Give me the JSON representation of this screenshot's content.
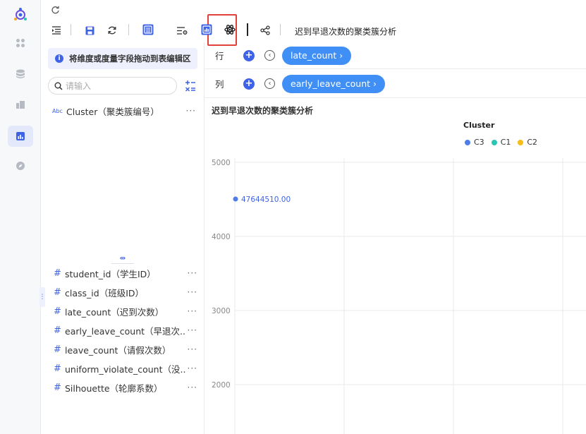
{
  "toolbar": {
    "refresh_icon": "refresh-icon",
    "chart_title": "迟到早退次数的聚类簇分析"
  },
  "fields_panel": {
    "hint": "将维度或度量字段拖动到表编辑区",
    "hint_icon": "i",
    "search_placeholder": "请输入",
    "dimensions": [
      {
        "type": "Abc",
        "name": "Cluster（聚类簇编号）"
      }
    ],
    "measures": [
      {
        "type": "#",
        "name": "student_id（学生ID）"
      },
      {
        "type": "#",
        "name": "class_id（班级ID）"
      },
      {
        "type": "#",
        "name": "late_count（迟到次数）"
      },
      {
        "type": "#",
        "name": "early_leave_count（早退次..."
      },
      {
        "type": "#",
        "name": "leave_count（请假次数）"
      },
      {
        "type": "#",
        "name": "uniform_violate_count（没..."
      },
      {
        "type": "#",
        "name": "Silhouette（轮廓系数）"
      }
    ],
    "more": "···"
  },
  "shelves": {
    "rows": {
      "label": "行",
      "pill": "late_count ›"
    },
    "columns": {
      "label": "列",
      "pill": "early_leave_count ›"
    }
  },
  "chart_data": {
    "type": "scatter",
    "title": "迟到早退次数的聚类簇分析",
    "legend_title": "Cluster",
    "legend_position": "top-right",
    "series": [
      {
        "name": "C3",
        "color": "#4e7de9"
      },
      {
        "name": "C1",
        "color": "#2bc5b4"
      },
      {
        "name": "C2",
        "color": "#f5bd16"
      }
    ],
    "y_ticks": [
      5000,
      4000,
      3000,
      2000
    ],
    "points": [
      {
        "series": "C3",
        "label": "47644510.00"
      }
    ],
    "grid": true
  }
}
